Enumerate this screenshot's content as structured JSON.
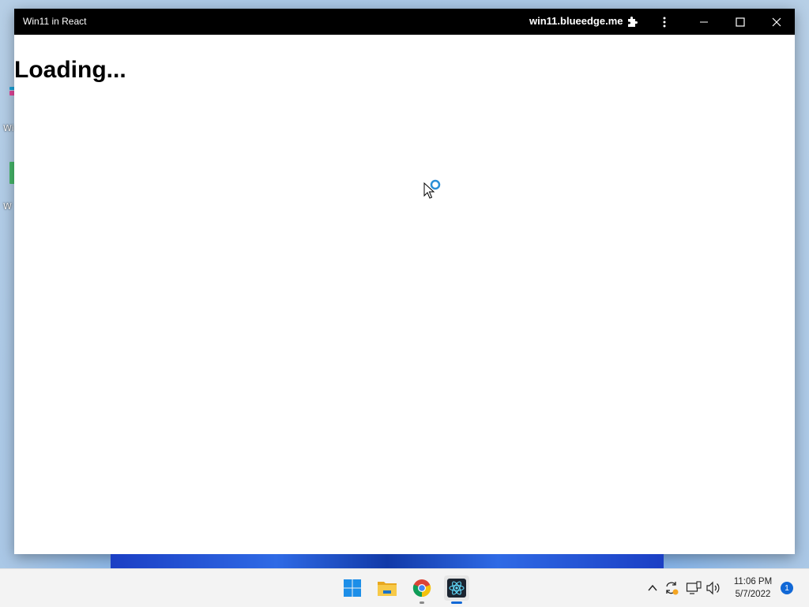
{
  "window": {
    "title": "Win11 in React",
    "url": "win11.blueedge.me"
  },
  "page": {
    "heading": "Loading..."
  },
  "desktop": {
    "icon_labels": [
      "Wi",
      "W"
    ]
  },
  "taskbar": {
    "apps": [
      {
        "name": "Start",
        "icon": "windows-logo-icon"
      },
      {
        "name": "File Explorer",
        "icon": "folder-icon"
      },
      {
        "name": "Google Chrome",
        "icon": "chrome-icon"
      },
      {
        "name": "React App",
        "icon": "react-icon"
      }
    ],
    "tray": {
      "time": "11:06 PM",
      "date": "5/7/2022",
      "notification_count": "1"
    }
  },
  "colors": {
    "titlebar": "#000000",
    "accent": "#1168d6",
    "taskbar": "#f3f3f3"
  }
}
